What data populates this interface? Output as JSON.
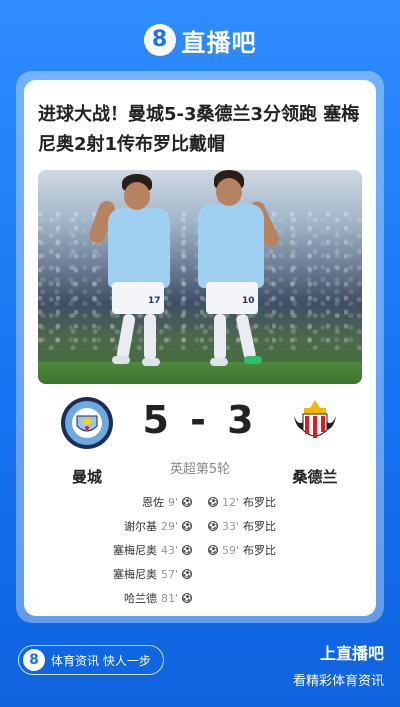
{
  "brand": {
    "logo_glyph": "8",
    "name": "直播吧"
  },
  "article": {
    "headline": "进球大战！曼城5-3桑德兰3分领跑 塞梅尼奥2射1传布罗比戴帽"
  },
  "match": {
    "home": {
      "name": "曼城",
      "crest_text": "MANCHESTER CITY",
      "crest_color": "#6cabdd"
    },
    "away": {
      "name": "桑德兰",
      "crest_color": "#e21b23"
    },
    "score": "5 - 3",
    "round": "英超第5轮",
    "home_events": [
      {
        "player": "恩佐",
        "minute": "9'"
      },
      {
        "player": "谢尔基",
        "minute": "29'"
      },
      {
        "player": "塞梅尼奥",
        "minute": "43'"
      },
      {
        "player": "塞梅尼奥",
        "minute": "57'"
      },
      {
        "player": "哈兰德",
        "minute": "81'"
      }
    ],
    "away_events": [
      {
        "player": "布罗比",
        "minute": "12'"
      },
      {
        "player": "布罗比",
        "minute": "33'"
      },
      {
        "player": "布罗比",
        "minute": "59'"
      }
    ],
    "photo_shirt_numbers": [
      "17",
      "10"
    ]
  },
  "footer": {
    "pill_glyph": "8",
    "pill_text": "体育资讯 快人一步",
    "title": "上直播吧",
    "subtitle": "看精彩体育资讯"
  },
  "colors": {
    "background": "#1a73f0",
    "card": "#ffffff",
    "accent": "#1a73f0"
  },
  "icons": [
    "logo-badge-icon",
    "soccer-ball-icon",
    "manchester-city-crest-icon",
    "sunderland-crest-icon"
  ]
}
